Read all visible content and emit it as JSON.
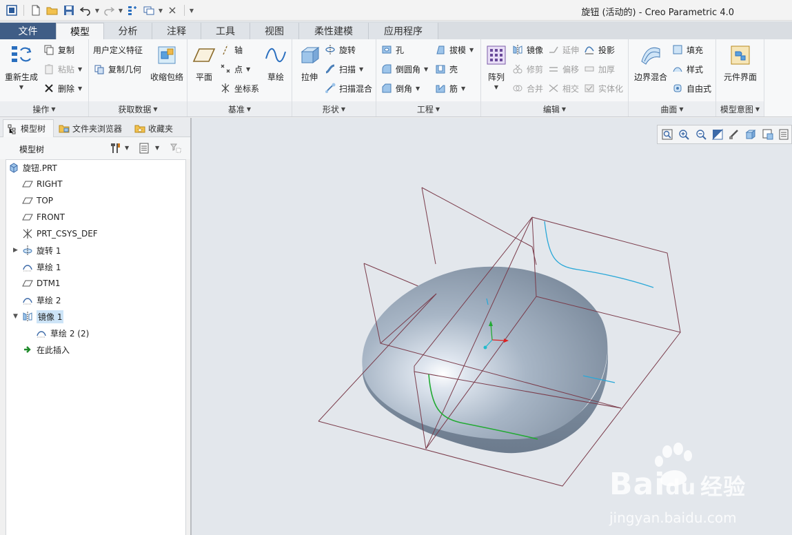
{
  "window": {
    "title": "旋钮 (活动的) - Creo Parametric 4.0"
  },
  "quick_access": [
    "new-icon",
    "open-icon",
    "save-icon",
    "undo-icon",
    "redo-icon",
    "regenerate-icon",
    "windows-icon",
    "close-icon"
  ],
  "tabs": [
    {
      "label": "文件"
    },
    {
      "label": "模型"
    },
    {
      "label": "分析"
    },
    {
      "label": "注释"
    },
    {
      "label": "工具"
    },
    {
      "label": "视图"
    },
    {
      "label": "柔性建模"
    },
    {
      "label": "应用程序"
    }
  ],
  "ribbon": {
    "operations": {
      "label": "操作",
      "regenerate": "重新生成",
      "copy": "复制",
      "paste": "粘贴",
      "delete": "删除"
    },
    "get_data": {
      "label": "获取数据",
      "udf": "用户定义特征",
      "copy_geom": "复制几何",
      "shrinkwrap": "收缩包络"
    },
    "datum": {
      "label": "基准",
      "plane": "平面",
      "axis": "轴",
      "point": "点",
      "csys": "坐标系",
      "sketch": "草绘"
    },
    "shapes": {
      "label": "形状",
      "extrude": "拉伸",
      "revolve": "旋转",
      "sweep": "扫描",
      "swept_blend": "扫描混合"
    },
    "engineering": {
      "label": "工程",
      "hole": "孔",
      "draft": "拔模",
      "round": "倒圆角",
      "shell": "壳",
      "chamfer": "倒角",
      "rib": "筋"
    },
    "editing": {
      "label": "编辑",
      "pattern": "阵列",
      "mirror": "镜像",
      "extend": "延伸",
      "project": "投影",
      "trim": "修剪",
      "offset": "偏移",
      "thicken": "加厚",
      "merge": "合并",
      "intersect": "相交",
      "solidify": "实体化"
    },
    "surfaces": {
      "label": "曲面",
      "boundary_blend": "边界混合",
      "fill": "填充",
      "style": "样式",
      "freestyle": "自由式"
    },
    "model_intent": {
      "label": "模型意图",
      "component_interface": "元件界面"
    }
  },
  "left_panel": {
    "tabs": [
      {
        "label": "模型树"
      },
      {
        "label": "文件夹浏览器"
      },
      {
        "label": "收藏夹"
      }
    ],
    "title": "模型树",
    "tree": [
      {
        "label": "旋钮.PRT",
        "icon": "part-icon",
        "level": 0
      },
      {
        "label": "RIGHT",
        "icon": "datum-plane-icon",
        "level": 1
      },
      {
        "label": "TOP",
        "icon": "datum-plane-icon",
        "level": 1
      },
      {
        "label": "FRONT",
        "icon": "datum-plane-icon",
        "level": 1
      },
      {
        "label": "PRT_CSYS_DEF",
        "icon": "csys-icon",
        "level": 1
      },
      {
        "label": "旋转 1",
        "icon": "revolve-icon",
        "level": 1,
        "expander": "▶"
      },
      {
        "label": "草绘 1",
        "icon": "sketch-icon",
        "level": 1
      },
      {
        "label": "DTM1",
        "icon": "datum-plane-icon",
        "level": 1
      },
      {
        "label": "草绘 2",
        "icon": "sketch-icon",
        "level": 1
      },
      {
        "label": "镜像 1",
        "icon": "mirror-icon",
        "level": 1,
        "expander": "▼",
        "selected": true
      },
      {
        "label": "草绘 2 (2)",
        "icon": "sketch-icon",
        "level": 2
      },
      {
        "label": "在此插入",
        "icon": "insert-here-icon",
        "level": 1
      }
    ]
  },
  "viewport": {
    "toolbar": [
      "refit-icon",
      "zoom-in-icon",
      "zoom-out-icon",
      "repaint-icon",
      "view-orient-icon",
      "display-style-icon",
      "saved-views-icon",
      "more-icon"
    ],
    "watermark": {
      "brand": "Bai",
      "paw": "du",
      "cn": "经验",
      "url": "jingyan.baidu.com"
    }
  }
}
